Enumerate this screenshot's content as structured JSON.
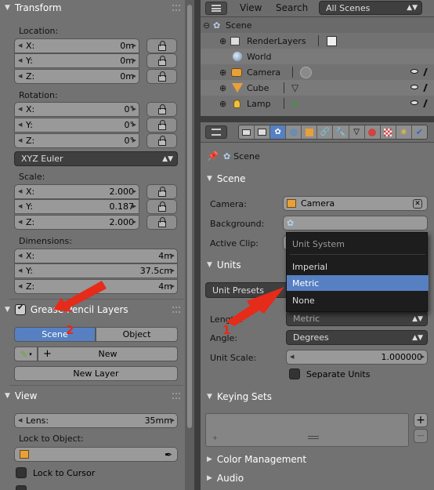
{
  "left_panel": {
    "transform": {
      "title": "Transform",
      "location_label": "Location:",
      "location": [
        {
          "axis": "X:",
          "value": "0m"
        },
        {
          "axis": "Y:",
          "value": "0m"
        },
        {
          "axis": "Z:",
          "value": "0m"
        }
      ],
      "rotation_label": "Rotation:",
      "rotation": [
        {
          "axis": "X:",
          "value": "0°"
        },
        {
          "axis": "Y:",
          "value": "0°"
        },
        {
          "axis": "Z:",
          "value": "0°"
        }
      ],
      "rotation_mode": "XYZ Euler",
      "scale_label": "Scale:",
      "scale": [
        {
          "axis": "X:",
          "value": "2.000"
        },
        {
          "axis": "Y:",
          "value": "0.187"
        },
        {
          "axis": "Z:",
          "value": "2.000"
        }
      ],
      "dimensions_label": "Dimensions:",
      "dimensions": [
        {
          "axis": "X:",
          "value": "4m"
        },
        {
          "axis": "Y:",
          "value": "37.5cm"
        },
        {
          "axis": "Z:",
          "value": "4m"
        }
      ]
    },
    "grease_pencil": {
      "title": "Grease Pencil Layers",
      "tab_scene": "Scene",
      "tab_object": "Object",
      "new_label": "New",
      "new_layer_label": "New Layer"
    },
    "view": {
      "title": "View",
      "lens_label": "Lens:",
      "lens_value": "35mm",
      "lock_to_object_label": "Lock to Object:",
      "lock_to_cursor_label": "Lock to Cursor"
    }
  },
  "outliner": {
    "menu_view": "View",
    "menu_search": "Search",
    "scope": "All Scenes",
    "items": [
      {
        "label": "Scene"
      },
      {
        "label": "RenderLayers"
      },
      {
        "label": "World"
      },
      {
        "label": "Camera"
      },
      {
        "label": "Cube"
      },
      {
        "label": "Lamp"
      }
    ]
  },
  "properties": {
    "breadcrumb": "Scene",
    "scene_panel": {
      "title": "Scene",
      "camera_label": "Camera:",
      "camera_value": "Camera",
      "background_label": "Background:",
      "active_clip_label": "Active Clip:"
    },
    "units_panel": {
      "title": "Units",
      "unit_presets": "Unit Presets",
      "length_label": "Length:",
      "length_value": "Metric",
      "angle_label": "Angle:",
      "angle_value": "Degrees",
      "unit_scale_label": "Unit Scale:",
      "unit_scale_value": "1.000000",
      "separate_units_label": "Separate Units"
    },
    "keying_sets_title": "Keying Sets",
    "color_management_title": "Color Management",
    "audio_title": "Audio"
  },
  "unit_system_menu": {
    "title": "Unit System",
    "options": [
      {
        "label": "Imperial"
      },
      {
        "label": "Metric"
      },
      {
        "label": "None"
      }
    ],
    "selected": "Metric"
  },
  "annotations": {
    "badge_1": "1",
    "badge_2": "2",
    "color": "#e52b1a"
  },
  "colors": {
    "highlight": "#5680c2",
    "panel": "#727272",
    "dark": "#3d3d3d"
  }
}
